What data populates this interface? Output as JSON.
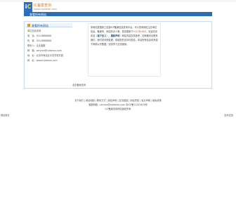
{
  "header": {
    "logo_letter": "C",
    "logo_text": "IC备案查询",
    "logo_sub": "www.icpbeian.com"
  },
  "nav": {
    "title": "查看所有网站"
  },
  "left_panel": {
    "title": "查看所有网站",
    "contact_lines": [
      "单位信息查询",
      "电　话：010-8888888",
      "传　真：010-8888888",
      "联系人：企业客服",
      "邮　箱：service@icpbeian.com",
      "地　址：北京市海淀区中关村软件园",
      "网　址：www.icpbeian.com"
    ]
  },
  "intro": {
    "p1": "本网站是国家工信部ICP备案信息查询平台，可以查询网站主办单位信息、备案号、网站负责人等。",
    "p2": "首页更新于",
    "p2_date": "2013年08月",
    "p3": "，欢迎访问本站（",
    "p3_bold": "客户至上",
    "p4": "）。",
    "p5_bold": "最新声明",
    "p6": "：网站内容仅供参考，如有疑问请联系我们，我们将尽快处理，感谢您的支持与配合。本站所有信息均来源于网络公开数据，仅供学习交流使用。"
  },
  "panel_footer": "北京备案查询",
  "footer": {
    "links": "关于我们 | 网站地图 | 联系方式 | 网站声明 | 友情链接 | 网站导航 | 免责声明 | 隐私政策",
    "line2": "客服邮箱：service@icpbeian.com 京ICP备12345678号",
    "line3": "ICP备案查询网站版权所有"
  },
  "status": {
    "left": "网站统计",
    "right": "技术支持"
  }
}
